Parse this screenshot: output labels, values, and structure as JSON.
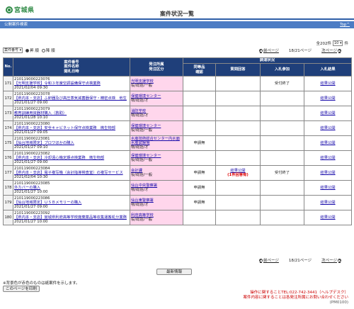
{
  "header": {
    "logo_text": "宮城県",
    "title": "案件状況一覧"
  },
  "bar": {
    "label": "公開案件検索",
    "top_link": "Top^"
  },
  "total": {
    "prefix": "全202件",
    "per_page": "10",
    "suffix": "件"
  },
  "sort": {
    "select": "案件番号",
    "asc": "昇 順",
    "desc": "降 順"
  },
  "pager": {
    "prev": "前ページ",
    "page": "18/21ページ",
    "next": "次ページ"
  },
  "table": {
    "headers": {
      "no": "No.",
      "case": "案件番号\n案件名称\n開札日時",
      "org": "発注所属\n発注区分",
      "survey": "調達状況",
      "reply": "同等品\n確認",
      "question": "質問回答",
      "bid": "入札参加",
      "result": "入札結果"
    },
    "rows": [
      {
        "no": "171",
        "id": "210119000223076",
        "name": "【光明支援学校】令和３年度空調設備保守点検業務",
        "date": "2021/02/04 09:30",
        "org": "光明支援学校",
        "cat": "役/総括/一般",
        "reply": "",
        "question": "",
        "bid": "受付終了",
        "result": "結果公開"
      },
      {
        "no": "172",
        "id": "210119000223078",
        "name": "【県内本・支店】ふ卵器及び高圧蒸気滅菌器保守・精密点検　他生",
        "date": "2021/01/27 09:00",
        "org": "保健環境センター",
        "cat": "物/総括/才",
        "reply": "",
        "question": "",
        "bid": "",
        "result": "結果公開"
      },
      {
        "no": "173",
        "id": "210119000223079",
        "name": "教育訓練用資器材購入（救助）",
        "date": "2021/01/28 10:10",
        "org": "消防学校",
        "cat": "物/総括/才",
        "reply": "",
        "question": "",
        "bid": "",
        "result": "結果公開"
      },
      {
        "no": "174",
        "id": "210119000223080",
        "name": "【県内本・支店】安全キャビネット保守点検業務　微生物部",
        "date": "2021/01/27 09:05",
        "org": "保健環境センター",
        "cat": "役/総括/一般",
        "reply": "",
        "question": "",
        "bid": "",
        "result": "結果公開"
      },
      {
        "no": "175",
        "id": "210119000223081",
        "name": "【仙台地域限定】プロワほかの購入",
        "date": "2021/01/27 09:10",
        "org": "水産技術総合センター内水面水産試験場",
        "cat": "物/総括/才",
        "reply": "申請無",
        "question": "",
        "bid": "",
        "result": "結果公開"
      },
      {
        "no": "176",
        "id": "210119000223082",
        "name": "【県内本・支店】冷却遠心機定期点検業務　微生物部",
        "date": "2021/01/27 09:00",
        "org": "保健環境センター",
        "cat": "役/総括/一般",
        "reply": "",
        "question": "",
        "bid": "",
        "result": "結果公開"
      },
      {
        "no": "177",
        "id": "210119000223084",
        "name": "【県内本・支店】電子複写機（会計指導検査室）の複写サービス",
        "date": "2021/02/04 10:30",
        "org": "会計課",
        "cat": "役/総括/一般",
        "reply": "申請無",
        "question": "結果公開",
        "question_note": "(1件回答有)",
        "bid": "受付終了",
        "result": "結果公開"
      },
      {
        "no": "178",
        "id": "210119000223085",
        "name": "外カバーの購入",
        "date": "2021/01/27 10:00",
        "org": "仙台中央警察署",
        "cat": "物/総括/才",
        "reply": "申請無",
        "question": "",
        "bid": "",
        "result": "結果公開"
      },
      {
        "no": "179",
        "id": "210119000223086",
        "name": "【仙台地域限定】ＵＳＢメモリーの購入",
        "date": "2021/01/27 09:00",
        "org": "仙台東警察署",
        "cat": "物/総括/才",
        "reply": "申請無",
        "question": "",
        "bid": "",
        "result": "結果公開"
      },
      {
        "no": "180",
        "id": "210119000223092",
        "name": "【県内本・支店】宮城県利府高等学校廃棄薬品等収集運搬処分業務",
        "date": "2021/01/27 10:00",
        "org": "利府高等学校",
        "cat": "役/総括/一般",
        "reply": "",
        "question": "",
        "bid": "",
        "result": "結果公開"
      }
    ]
  },
  "buttons": {
    "latest": "最新情報",
    "print": "このページを印刷"
  },
  "note": "※背景色が赤色のものは紙案件を示します。",
  "contact": {
    "line1": "操作に関することTEL:022-742-3441（ヘルプデスク）",
    "line2": "案件内容に関することは各発注所属にお問い合わせください",
    "id": "(PM0100)"
  }
}
